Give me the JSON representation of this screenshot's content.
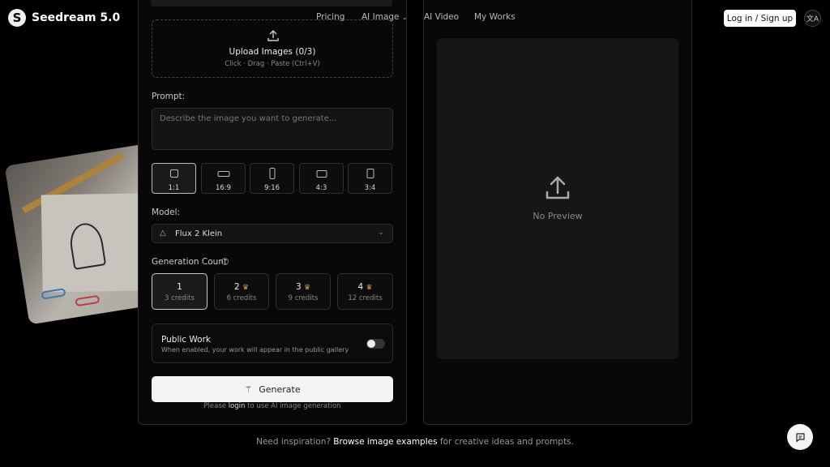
{
  "header": {
    "logo_mark": "S",
    "brand": "Seedream 5.0",
    "nav": [
      "Pricing",
      "AI Image",
      "AI Video",
      "My Works"
    ],
    "login_label": "Log in / Sign up",
    "lang_icon": "translate-icon"
  },
  "upload": {
    "title": "Upload Images (0/3)",
    "subtitle": "Click · Drag · Paste (Ctrl+V)"
  },
  "prompt": {
    "label": "Prompt:",
    "placeholder": "Describe the image you want to generate..."
  },
  "ratios": [
    {
      "label": "1:1",
      "active": true
    },
    {
      "label": "16:9",
      "active": false
    },
    {
      "label": "9:16",
      "active": false
    },
    {
      "label": "4:3",
      "active": false
    },
    {
      "label": "3:4",
      "active": false
    }
  ],
  "model": {
    "label": "Model:",
    "selected": "Flux 2 Klein"
  },
  "generation_count": {
    "label": "Generation Count",
    "options": [
      {
        "count": "1",
        "credits": "3 credits",
        "premium": false,
        "active": true
      },
      {
        "count": "2",
        "credits": "6 credits",
        "premium": true,
        "active": false
      },
      {
        "count": "3",
        "credits": "9 credits",
        "premium": true,
        "active": false
      },
      {
        "count": "4",
        "credits": "12 credits",
        "premium": true,
        "active": false
      }
    ]
  },
  "public_work": {
    "title": "Public Work",
    "subtitle": "When enabled, your work will appear in the public gallery",
    "enabled": false
  },
  "generate": {
    "label": "Generate",
    "note_prefix": "Please",
    "note_link": "login",
    "note_suffix": "to use AI image generation"
  },
  "preview": {
    "empty_text": "No Preview"
  },
  "footer": {
    "prefix": "Need inspiration?",
    "link": "Browse image examples",
    "suffix": "for creative ideas and prompts."
  },
  "colors": {
    "background": "#000000",
    "accent": "#f4f4f4",
    "crown": "#d4a63a"
  }
}
